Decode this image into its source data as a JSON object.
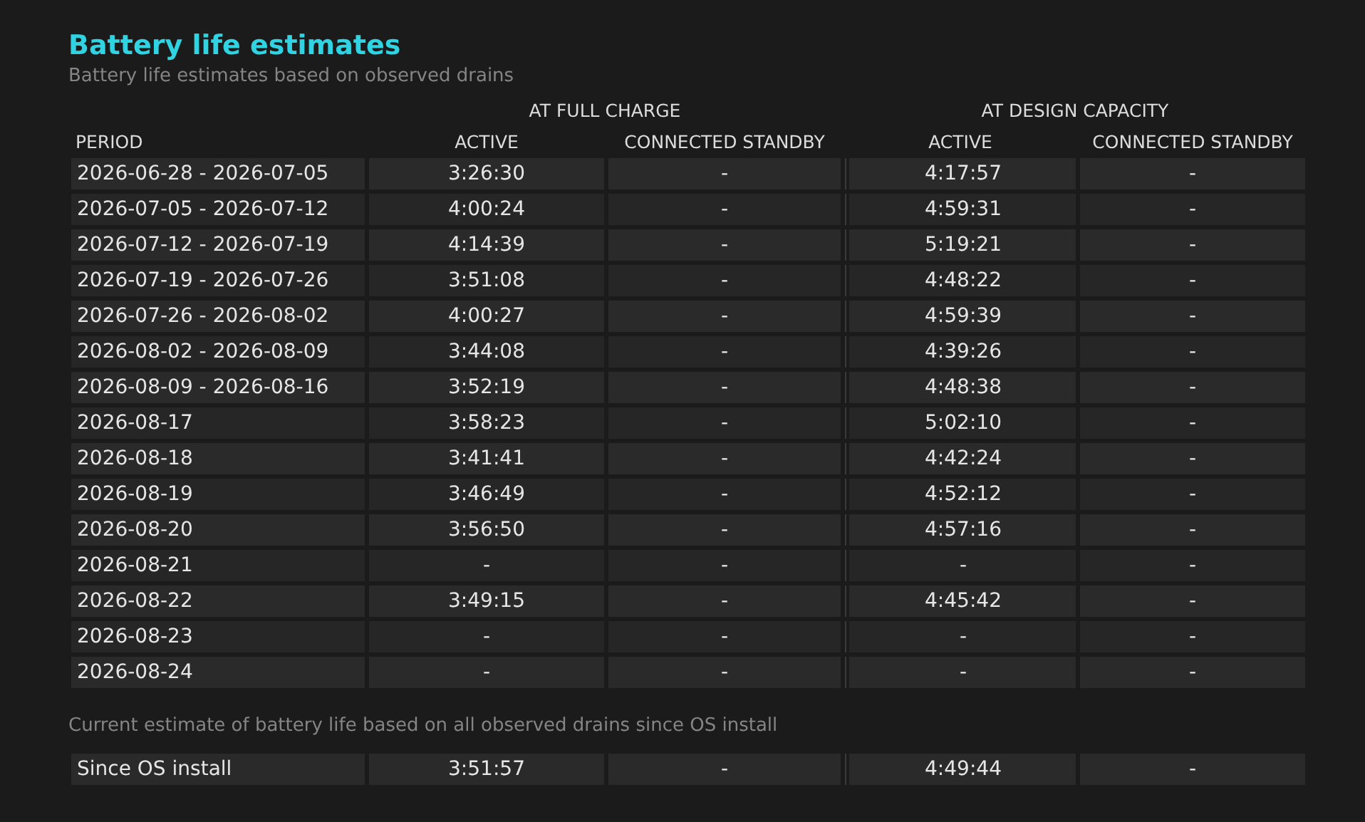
{
  "title": "Battery life estimates",
  "subtitle": "Battery life estimates based on observed drains",
  "column_groups": [
    "AT FULL CHARGE",
    "AT DESIGN CAPACITY"
  ],
  "columns": [
    "PERIOD",
    "ACTIVE",
    "CONNECTED STANDBY",
    "ACTIVE",
    "CONNECTED STANDBY"
  ],
  "rows": [
    [
      "2026-06-28 - 2026-07-05",
      "3:26:30",
      "-",
      "4:17:57",
      "-"
    ],
    [
      "2026-07-05 - 2026-07-12",
      "4:00:24",
      "-",
      "4:59:31",
      "-"
    ],
    [
      "2026-07-12 - 2026-07-19",
      "4:14:39",
      "-",
      "5:19:21",
      "-"
    ],
    [
      "2026-07-19 - 2026-07-26",
      "3:51:08",
      "-",
      "4:48:22",
      "-"
    ],
    [
      "2026-07-26 - 2026-08-02",
      "4:00:27",
      "-",
      "4:59:39",
      "-"
    ],
    [
      "2026-08-02 - 2026-08-09",
      "3:44:08",
      "-",
      "4:39:26",
      "-"
    ],
    [
      "2026-08-09 - 2026-08-16",
      "3:52:19",
      "-",
      "4:48:38",
      "-"
    ],
    [
      "2026-08-17",
      "3:58:23",
      "-",
      "5:02:10",
      "-"
    ],
    [
      "2026-08-18",
      "3:41:41",
      "-",
      "4:42:24",
      "-"
    ],
    [
      "2026-08-19",
      "3:46:49",
      "-",
      "4:52:12",
      "-"
    ],
    [
      "2026-08-20",
      "3:56:50",
      "-",
      "4:57:16",
      "-"
    ],
    [
      "2026-08-21",
      "-",
      "-",
      "-",
      "-"
    ],
    [
      "2026-08-22",
      "3:49:15",
      "-",
      "4:45:42",
      "-"
    ],
    [
      "2026-08-23",
      "-",
      "-",
      "-",
      "-"
    ],
    [
      "2026-08-24",
      "-",
      "-",
      "-",
      "-"
    ]
  ],
  "footer_caption": "Current estimate of battery life based on all observed drains since OS install",
  "footer_row": [
    "Since OS install",
    "3:51:57",
    "-",
    "4:49:44",
    "-"
  ]
}
